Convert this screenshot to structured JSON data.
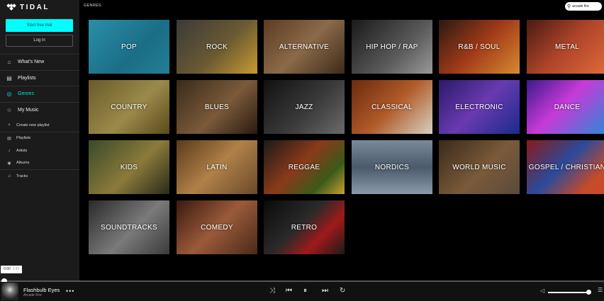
{
  "app": {
    "logo_text": "TIDAL"
  },
  "sidebar": {
    "start_trial": "Start free trial",
    "login": "Log in",
    "nav": [
      {
        "label": "What's New",
        "icon": "home-icon"
      },
      {
        "label": "Playlists",
        "icon": "playlist-icon"
      },
      {
        "label": "Genres",
        "icon": "genres-icon",
        "active": true
      },
      {
        "label": "My Music",
        "icon": "star-icon"
      }
    ],
    "my_music": [
      {
        "label": "Create new playlist",
        "icon": "plus-icon"
      },
      {
        "label": "Playlists",
        "icon": "playlist-icon"
      },
      {
        "label": "Artists",
        "icon": "artist-icon"
      },
      {
        "label": "Albums",
        "icon": "album-icon"
      },
      {
        "label": "Tracks",
        "icon": "note-icon"
      }
    ]
  },
  "header": {
    "title": "GENRES",
    "search_value": "arcade fire"
  },
  "genres": [
    {
      "label": "POP"
    },
    {
      "label": "ROCK"
    },
    {
      "label": "ALTERNATIVE"
    },
    {
      "label": "HIP HOP / RAP"
    },
    {
      "label": "R&B / SOUL"
    },
    {
      "label": "METAL"
    },
    {
      "label": "COUNTRY"
    },
    {
      "label": "BLUES"
    },
    {
      "label": "JAZZ"
    },
    {
      "label": "CLASSICAL"
    },
    {
      "label": "ELECTRONIC"
    },
    {
      "label": "DANCE"
    },
    {
      "label": "KIDS"
    },
    {
      "label": "LATIN"
    },
    {
      "label": "REGGAE"
    },
    {
      "label": "NORDICS"
    },
    {
      "label": "WORLD MUSIC"
    },
    {
      "label": "GOSPEL / CHRISTIAN"
    },
    {
      "label": "SOUNDTRACKS"
    },
    {
      "label": "COMEDY"
    },
    {
      "label": "RETRO"
    }
  ],
  "player": {
    "elapsed": "0:00",
    "duration": "2:42",
    "track": "Flashbulb Eyes",
    "artist": "Arcade Fire",
    "progress": 0.0,
    "volume": 0.9
  }
}
